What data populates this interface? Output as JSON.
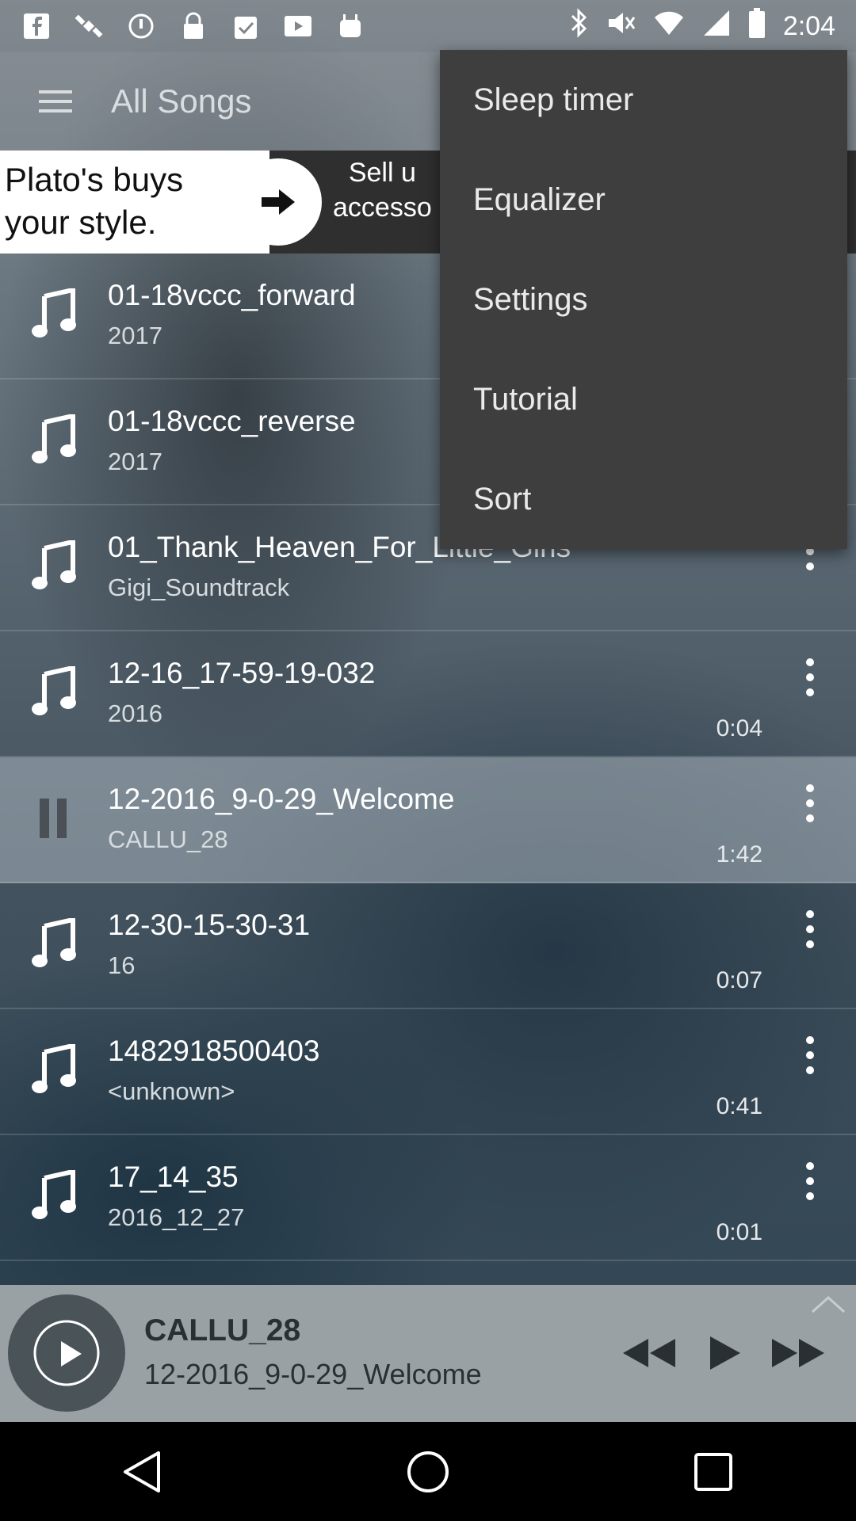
{
  "status_bar": {
    "time": "2:04",
    "left_icons": [
      "facebook-icon",
      "satellite-icon",
      "alarm-off-icon",
      "lock-icon",
      "clipboard-check-icon",
      "video-icon",
      "android-icon"
    ],
    "right_icons": [
      "bluetooth-icon",
      "mute-icon",
      "wifi-icon",
      "signal-icon",
      "battery-icon"
    ]
  },
  "toolbar": {
    "title": "All Songs"
  },
  "ad": {
    "left_text_line1": "Plato's buys",
    "left_text_line2": "your style.",
    "right_text_line1": "Sell u",
    "right_text_line2": "accesso"
  },
  "songs": [
    {
      "title": "01-18vccc_forward",
      "subtitle": "2017",
      "time": ""
    },
    {
      "title": "01-18vccc_reverse",
      "subtitle": "2017",
      "time": ""
    },
    {
      "title": "01_Thank_Heaven_For_Little_Girls",
      "subtitle": "Gigi_Soundtrack",
      "time": ""
    },
    {
      "title": "12-16_17-59-19-032",
      "subtitle": "2016",
      "time": "0:04"
    },
    {
      "title": "12-2016_9-0-29_Welcome",
      "subtitle": "CALLU_28",
      "time": "1:42"
    },
    {
      "title": "12-30-15-30-31",
      "subtitle": "16",
      "time": "0:07"
    },
    {
      "title": "1482918500403",
      "subtitle": "<unknown>",
      "time": "0:41"
    },
    {
      "title": "17_14_35",
      "subtitle": "2016_12_27",
      "time": "0:01"
    }
  ],
  "player": {
    "artist": "CALLU_28",
    "title": "12-2016_9-0-29_Welcome"
  },
  "menu": {
    "items": [
      "Sleep timer",
      "Equalizer",
      "Settings",
      "Tutorial",
      "Sort"
    ]
  },
  "colors": {
    "menu_bg": "#3e3e3e",
    "player_bg": "#9aa1a5",
    "playing_row": "#aab4be"
  }
}
